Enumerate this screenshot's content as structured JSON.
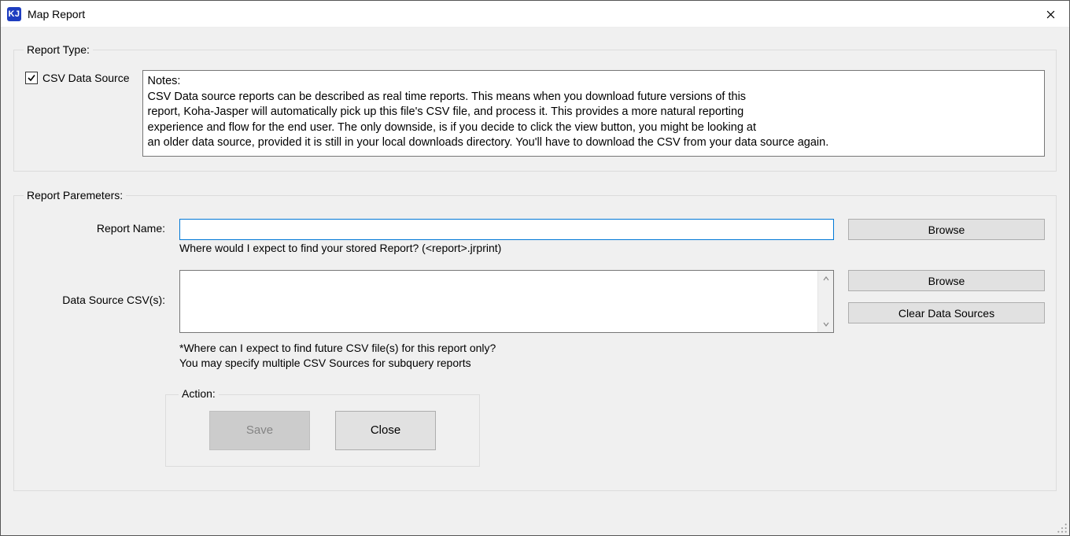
{
  "window": {
    "icon_text": "KJ",
    "title": "Map Report"
  },
  "report_type": {
    "legend": "Report Type:",
    "csv_checkbox_label": "CSV Data Source",
    "csv_checked": true,
    "notes_header": "Notes:",
    "notes_line1": "CSV Data source reports can be described as real time reports. This means when you download future versions of this",
    "notes_line2": "report, Koha-Jasper will automatically pick up this file's CSV file, and process it.  This provides a more natural reporting",
    "notes_line3": "experience and flow for the end user. The only downside, is if you decide to click the view button, you might be looking at",
    "notes_line4": "an older data source, provided it is still in your local downloads directory. You'll have to download the CSV from your data source again."
  },
  "report_params": {
    "legend": "Report Paremeters:",
    "report_name_label": "Report Name:",
    "report_name_value": "",
    "report_name_hint": "Where would I expect to find your stored Report? (<report>.jrprint)",
    "browse1": "Browse",
    "data_source_label": "Data Source CSV(s):",
    "data_source_value": "",
    "data_source_hint1": "*Where can I expect to find  future CSV file(s) for this report only?",
    "data_source_hint2": "You may specify multiple CSV Sources for subquery reports",
    "browse2": "Browse",
    "clear_sources": "Clear Data Sources",
    "action_legend": "Action:",
    "save": "Save",
    "close": "Close"
  }
}
